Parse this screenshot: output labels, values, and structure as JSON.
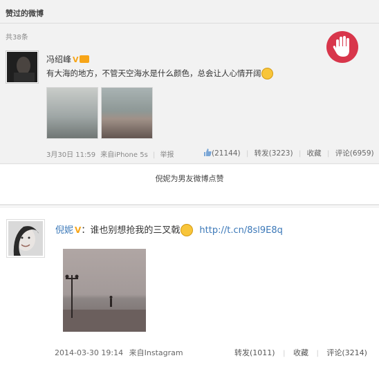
{
  "header": {
    "title": "赞过的微博",
    "count": "共38条"
  },
  "post1": {
    "username": "冯绍峰",
    "text": "有大海的地方，不管天空海水是什么颜色，总会让人心情开阔",
    "date": "3月30日 11:59",
    "source": "来自iPhone 5s",
    "report": "举报",
    "likes": "(21144)",
    "repost": "转发(3223)",
    "favorite": "收藏",
    "comment": "评论(6959)"
  },
  "caption": "倪妮为男友微博点赞",
  "post2": {
    "username": "倪妮",
    "text": "：谁也别想抢我的三叉戟",
    "link": "http://t.cn/8sl9E8q",
    "date": "2014-03-30 19:14",
    "source": "来自Instagram",
    "repost": "转发(1011)",
    "favorite": "收藏",
    "comment": "评论(3214)"
  },
  "colors": {
    "panel": "#f2f2f2",
    "link": "#3b78b8",
    "badge": "#f7a518",
    "like_circle": "#d8364b"
  }
}
